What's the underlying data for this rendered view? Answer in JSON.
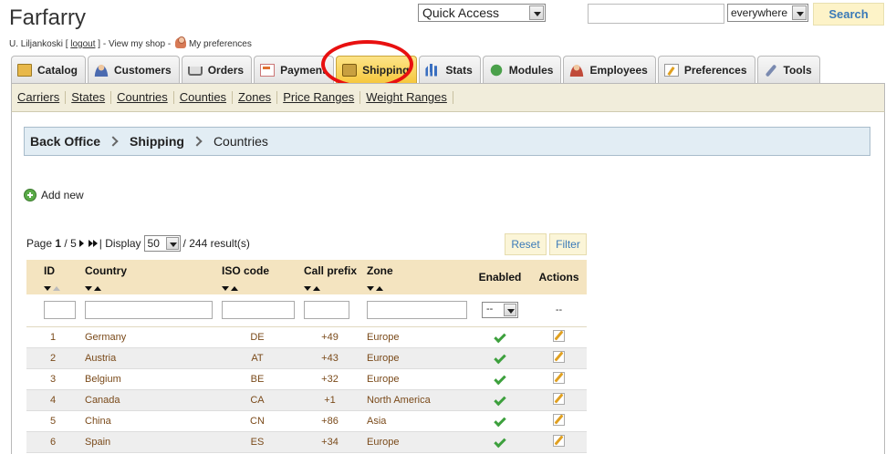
{
  "header": {
    "shop_name": "Farfarry",
    "user_name": "U. Liljankoski",
    "logout_label": "logout",
    "view_shop_label": "View my shop",
    "my_preferences_label": "My preferences",
    "quick_access_value": "Quick Access",
    "search_value": "",
    "search_scope_value": "everywhere",
    "search_button_label": "Search"
  },
  "tabs": [
    {
      "label": "Catalog",
      "icon": "catalog-icon",
      "active": false
    },
    {
      "label": "Customers",
      "icon": "customers-icon",
      "active": false
    },
    {
      "label": "Orders",
      "icon": "cart-icon",
      "active": false
    },
    {
      "label": "Payment",
      "icon": "payment-icon",
      "active": false
    },
    {
      "label": "Shipping",
      "icon": "truck-icon",
      "active": true
    },
    {
      "label": "Stats",
      "icon": "chart-icon",
      "active": false
    },
    {
      "label": "Modules",
      "icon": "puzzle-icon",
      "active": false
    },
    {
      "label": "Employees",
      "icon": "employee-icon",
      "active": false
    },
    {
      "label": "Preferences",
      "icon": "pencil-icon",
      "active": false
    },
    {
      "label": "Tools",
      "icon": "wrench-icon",
      "active": false
    }
  ],
  "subnav": [
    "Carriers",
    "States",
    "Countries",
    "Counties",
    "Zones",
    "Price Ranges",
    "Weight Ranges"
  ],
  "breadcrumb": [
    "Back Office",
    "Shipping",
    "Countries"
  ],
  "add_new_label": "Add new",
  "pagination": {
    "page_label": "Page",
    "current_page": "1",
    "total_pages": "/ 5",
    "display_label": "| Display",
    "display_value": "50",
    "results_text": "/ 244 result(s)"
  },
  "buttons": {
    "reset": "Reset",
    "filter": "Filter"
  },
  "table": {
    "headers": {
      "id": "ID",
      "country": "Country",
      "iso": "ISO code",
      "prefix": "Call prefix",
      "zone": "Zone",
      "enabled": "Enabled",
      "actions": "Actions"
    },
    "enabled_filter_value": "--",
    "actions_filter_text": "--",
    "rows": [
      {
        "id": "1",
        "country": "Germany",
        "iso": "DE",
        "prefix": "+49",
        "zone": "Europe",
        "enabled": true
      },
      {
        "id": "2",
        "country": "Austria",
        "iso": "AT",
        "prefix": "+43",
        "zone": "Europe",
        "enabled": true
      },
      {
        "id": "3",
        "country": "Belgium",
        "iso": "BE",
        "prefix": "+32",
        "zone": "Europe",
        "enabled": true
      },
      {
        "id": "4",
        "country": "Canada",
        "iso": "CA",
        "prefix": "+1",
        "zone": "North America",
        "enabled": true
      },
      {
        "id": "5",
        "country": "China",
        "iso": "CN",
        "prefix": "+86",
        "zone": "Asia",
        "enabled": true
      },
      {
        "id": "6",
        "country": "Spain",
        "iso": "ES",
        "prefix": "+34",
        "zone": "Europe",
        "enabled": true
      }
    ]
  },
  "colors": {
    "active_tab": "#f6c83e",
    "subnav_bg": "#f1eddb",
    "breadcrumb_bg": "#e2edf4",
    "table_header_bg": "#f4e4c0",
    "highlight_ring": "#e81010",
    "button_text": "#3a7ab8"
  }
}
